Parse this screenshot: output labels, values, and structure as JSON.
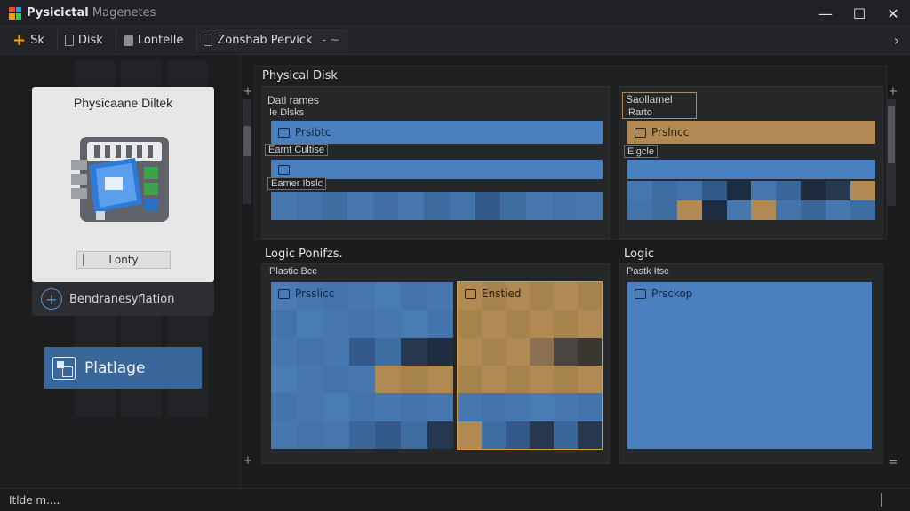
{
  "window": {
    "title_bold": "Pysicictal",
    "title_rest": " Magenetes",
    "minimize": "—",
    "maximize": "☐",
    "close": "✕"
  },
  "toolbar": {
    "items": [
      {
        "label": "Sk",
        "icon": "plus-icon"
      },
      {
        "label": "Disk",
        "icon": "document-icon"
      },
      {
        "label": "Lontelle",
        "icon": "disk-icon"
      },
      {
        "label": "Zonshab Pervick",
        "icon": "document-icon",
        "suffix": "- ~"
      }
    ],
    "overflow": "›"
  },
  "sidebar": {
    "card_title": "Physicaane Diltek",
    "card_label": "Lonty",
    "footer_label": "Bendranesyflation",
    "primary_button": "Platlage"
  },
  "main": {
    "physical_section": "Physical Disk",
    "physical_left": {
      "label_a": "Datl rames",
      "label_b": "Ie Dlsks",
      "bar1": "Prsibtc",
      "label_c": "Earnt Cultise",
      "label_d": "Eamer Ibslc"
    },
    "physical_right": {
      "label_a": "Saollamel",
      "label_b": "Rarto",
      "bar1": "Prslncc",
      "label_c": "Elgcle"
    },
    "logic_section_left": "Logic Ponifzs.",
    "logic_section_right": "Logic",
    "logic_left": {
      "label_a": "Plastic Bcc",
      "bar_blue": "Prsslicc",
      "bar_gold": "Enstied"
    },
    "logic_right": {
      "label_a": "Pastk Itsc",
      "bar_blue": "Prsckop"
    }
  },
  "status": {
    "text": "Itlde m...."
  },
  "colors": {
    "accent_blue": "#4a80bf",
    "accent_gold": "#b08a52",
    "background": "#1f2022"
  }
}
